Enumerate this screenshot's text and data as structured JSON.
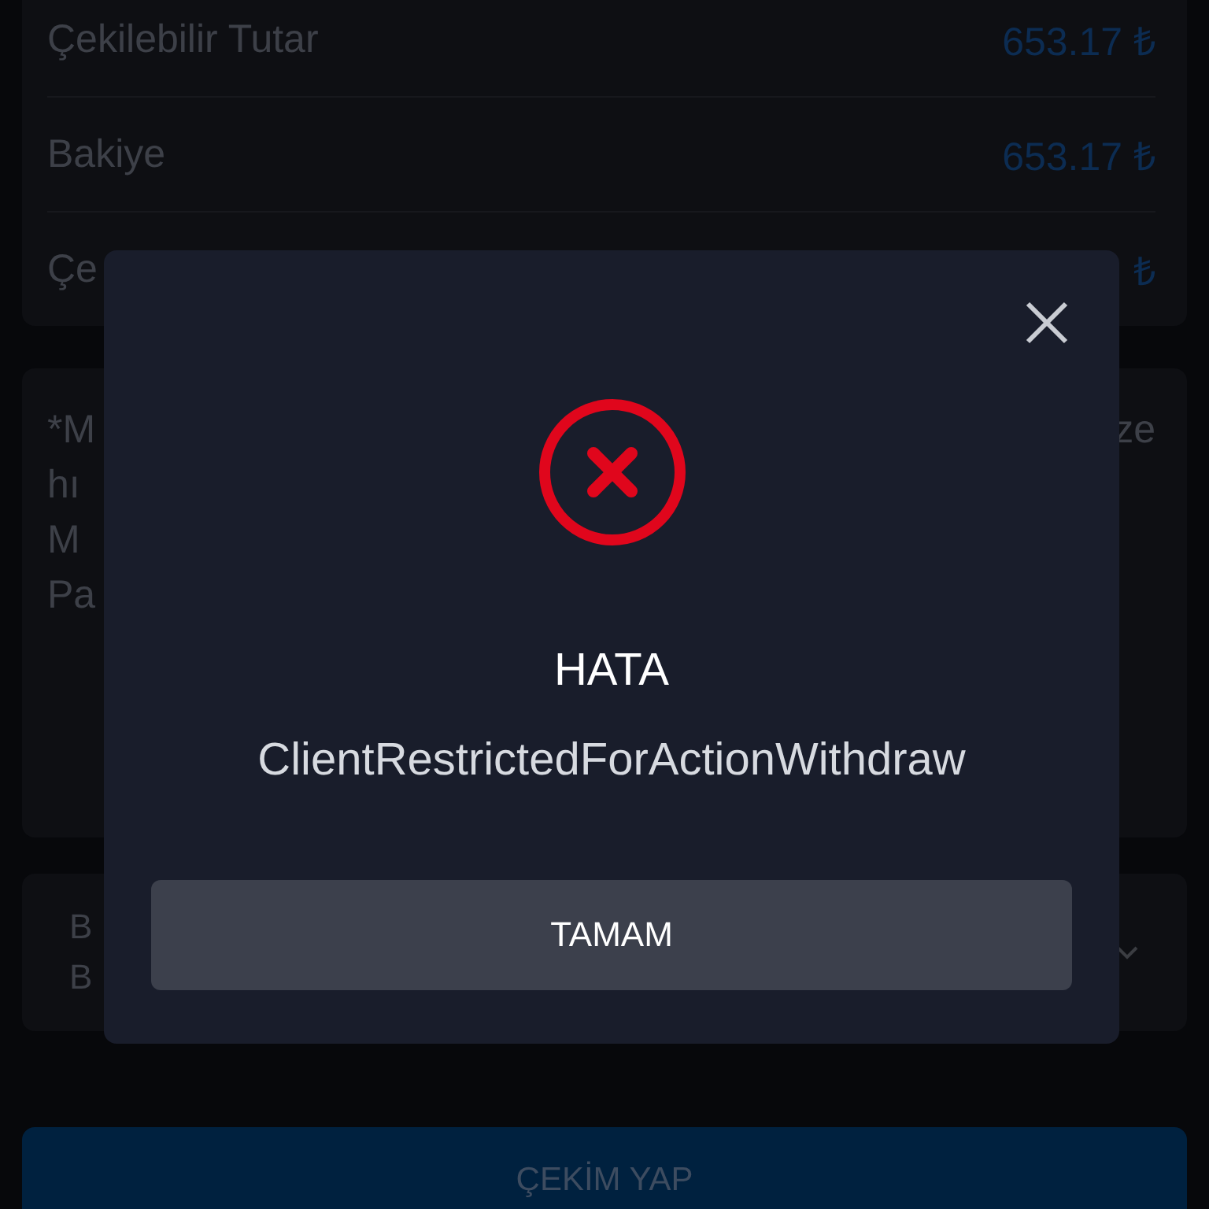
{
  "balance_rows": [
    {
      "label": "Çekilebilir Tutar",
      "value": "653.17 ₺"
    },
    {
      "label": "Bakiye",
      "value": "653.17 ₺"
    },
    {
      "label": "Çe",
      "value": "₺"
    }
  ],
  "notice_lines": [
    {
      "left": "*M",
      "right": "ze"
    },
    {
      "left": "hı"
    },
    {
      "left": "M"
    },
    {
      "left": "Pa"
    }
  ],
  "select_lines": [
    "B",
    "B"
  ],
  "submit_button": "ÇEKİM YAP",
  "dialog": {
    "title": "HATA",
    "message": "ClientRestrictedForActionWithdraw",
    "button": "TAMAM"
  }
}
